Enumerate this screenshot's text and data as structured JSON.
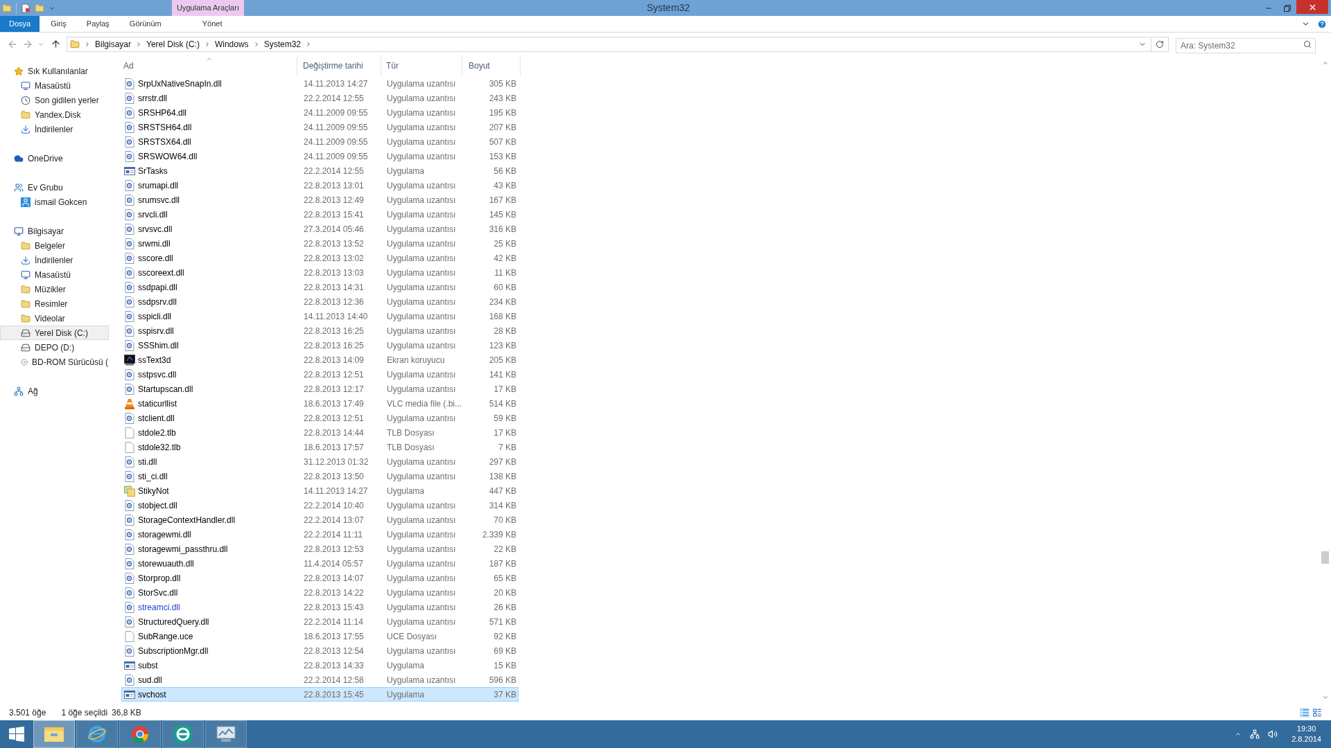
{
  "window": {
    "title": "System32",
    "context_tab": "Uygulama Araçları"
  },
  "ribbon_tabs": [
    {
      "label": "Dosya",
      "selected": true
    },
    {
      "label": "Giriş",
      "selected": false
    },
    {
      "label": "Paylaş",
      "selected": false
    },
    {
      "label": "Görünüm",
      "selected": false
    },
    {
      "label": "Yönet",
      "selected": false
    }
  ],
  "breadcrumbs": [
    "Bilgisayar",
    "Yerel Disk (C:)",
    "Windows",
    "System32"
  ],
  "search": {
    "placeholder": "Ara: System32"
  },
  "sidebar": {
    "groups": [
      {
        "label": "Sık Kullanılanlar",
        "kind": "star",
        "selected": false,
        "children": [
          {
            "label": "Masaüstü",
            "kind": "desktop",
            "selected": false
          },
          {
            "label": "Son gidilen yerler",
            "kind": "recent",
            "selected": false
          },
          {
            "label": "Yandex.Disk",
            "kind": "folder",
            "selected": false
          },
          {
            "label": "İndirilenler",
            "kind": "download",
            "selected": false
          }
        ]
      },
      {
        "label": "OneDrive",
        "kind": "cloud",
        "selected": false
      },
      {
        "label": "Ev Grubu",
        "kind": "homegroup",
        "selected": false,
        "children": [
          {
            "label": "ismail Gokcen",
            "kind": "user",
            "selected": false
          }
        ]
      },
      {
        "label": "Bilgisayar",
        "kind": "computer",
        "selected": false,
        "children": [
          {
            "label": "Belgeler",
            "kind": "folder",
            "selected": false
          },
          {
            "label": "İndirilenler",
            "kind": "download",
            "selected": false
          },
          {
            "label": "Masaüstü",
            "kind": "desktop",
            "selected": false
          },
          {
            "label": "Müzikler",
            "kind": "folder",
            "selected": false
          },
          {
            "label": "Resimler",
            "kind": "folder",
            "selected": false
          },
          {
            "label": "Videolar",
            "kind": "folder",
            "selected": false
          },
          {
            "label": "Yerel Disk (C:)",
            "kind": "drive",
            "selected": true
          },
          {
            "label": "DEPO (D:)",
            "kind": "drive",
            "selected": false
          },
          {
            "label": "BD-ROM Sürücüsü (",
            "kind": "disc",
            "selected": false
          }
        ]
      },
      {
        "label": "Ağ",
        "kind": "network",
        "selected": false
      }
    ]
  },
  "table": {
    "columns": [
      "Ad",
      "Değiştirme tarihi",
      "Tür",
      "Boyut"
    ],
    "rows": [
      {
        "name": "SrpUxNativeSnapIn.dll",
        "date": "14.11.2013 14:27",
        "type": "Uygulama uzantısı",
        "size": "305 KB",
        "kind": "dll",
        "compressed": false,
        "selected": false
      },
      {
        "name": "srrstr.dll",
        "date": "22.2.2014 12:55",
        "type": "Uygulama uzantısı",
        "size": "243 KB",
        "kind": "dll",
        "compressed": false,
        "selected": false
      },
      {
        "name": "SRSHP64.dll",
        "date": "24.11.2009 09:55",
        "type": "Uygulama uzantısı",
        "size": "195 KB",
        "kind": "dll",
        "compressed": false,
        "selected": false
      },
      {
        "name": "SRSTSH64.dll",
        "date": "24.11.2009 09:55",
        "type": "Uygulama uzantısı",
        "size": "207 KB",
        "kind": "dll",
        "compressed": false,
        "selected": false
      },
      {
        "name": "SRSTSX64.dll",
        "date": "24.11.2009 09:55",
        "type": "Uygulama uzantısı",
        "size": "507 KB",
        "kind": "dll",
        "compressed": false,
        "selected": false
      },
      {
        "name": "SRSWOW64.dll",
        "date": "24.11.2009 09:55",
        "type": "Uygulama uzantısı",
        "size": "153 KB",
        "kind": "dll",
        "compressed": false,
        "selected": false
      },
      {
        "name": "SrTasks",
        "date": "22.2.2014 12:55",
        "type": "Uygulama",
        "size": "56 KB",
        "kind": "exe",
        "compressed": false,
        "selected": false
      },
      {
        "name": "srumapi.dll",
        "date": "22.8.2013 13:01",
        "type": "Uygulama uzantısı",
        "size": "43 KB",
        "kind": "dll",
        "compressed": false,
        "selected": false
      },
      {
        "name": "srumsvc.dll",
        "date": "22.8.2013 12:49",
        "type": "Uygulama uzantısı",
        "size": "167 KB",
        "kind": "dll",
        "compressed": false,
        "selected": false
      },
      {
        "name": "srvcli.dll",
        "date": "22.8.2013 15:41",
        "type": "Uygulama uzantısı",
        "size": "145 KB",
        "kind": "dll",
        "compressed": false,
        "selected": false
      },
      {
        "name": "srvsvc.dll",
        "date": "27.3.2014 05:46",
        "type": "Uygulama uzantısı",
        "size": "316 KB",
        "kind": "dll",
        "compressed": false,
        "selected": false
      },
      {
        "name": "srwmi.dll",
        "date": "22.8.2013 13:52",
        "type": "Uygulama uzantısı",
        "size": "25 KB",
        "kind": "dll",
        "compressed": false,
        "selected": false
      },
      {
        "name": "sscore.dll",
        "date": "22.8.2013 13:02",
        "type": "Uygulama uzantısı",
        "size": "42 KB",
        "kind": "dll",
        "compressed": false,
        "selected": false
      },
      {
        "name": "sscoreext.dll",
        "date": "22.8.2013 13:03",
        "type": "Uygulama uzantısı",
        "size": "11 KB",
        "kind": "dll",
        "compressed": false,
        "selected": false
      },
      {
        "name": "ssdpapi.dll",
        "date": "22.8.2013 14:31",
        "type": "Uygulama uzantısı",
        "size": "60 KB",
        "kind": "dll",
        "compressed": false,
        "selected": false
      },
      {
        "name": "ssdpsrv.dll",
        "date": "22.8.2013 12:36",
        "type": "Uygulama uzantısı",
        "size": "234 KB",
        "kind": "dll",
        "compressed": false,
        "selected": false
      },
      {
        "name": "sspicli.dll",
        "date": "14.11.2013 14:40",
        "type": "Uygulama uzantısı",
        "size": "168 KB",
        "kind": "dll",
        "compressed": false,
        "selected": false
      },
      {
        "name": "sspisrv.dll",
        "date": "22.8.2013 16:25",
        "type": "Uygulama uzantısı",
        "size": "28 KB",
        "kind": "dll",
        "compressed": false,
        "selected": false
      },
      {
        "name": "SSShim.dll",
        "date": "22.8.2013 16:25",
        "type": "Uygulama uzantısı",
        "size": "123 KB",
        "kind": "dll",
        "compressed": false,
        "selected": false
      },
      {
        "name": "ssText3d",
        "date": "22.8.2013 14:09",
        "type": "Ekran koruyucu",
        "size": "205 KB",
        "kind": "screensaver",
        "compressed": false,
        "selected": false
      },
      {
        "name": "sstpsvc.dll",
        "date": "22.8.2013 12:51",
        "type": "Uygulama uzantısı",
        "size": "141 KB",
        "kind": "dll",
        "compressed": false,
        "selected": false
      },
      {
        "name": "Startupscan.dll",
        "date": "22.8.2013 12:17",
        "type": "Uygulama uzantısı",
        "size": "17 KB",
        "kind": "dll",
        "compressed": false,
        "selected": false
      },
      {
        "name": "staticurllist",
        "date": "18.6.2013 17:49",
        "type": "VLC media file (.bi...",
        "size": "514 KB",
        "kind": "cone",
        "compressed": false,
        "selected": false
      },
      {
        "name": "stclient.dll",
        "date": "22.8.2013 12:51",
        "type": "Uygulama uzantısı",
        "size": "59 KB",
        "kind": "dll",
        "compressed": false,
        "selected": false
      },
      {
        "name": "stdole2.tlb",
        "date": "22.8.2013 14:44",
        "type": "TLB Dosyası",
        "size": "17 KB",
        "kind": "blank",
        "compressed": false,
        "selected": false
      },
      {
        "name": "stdole32.tlb",
        "date": "18.6.2013 17:57",
        "type": "TLB Dosyası",
        "size": "7 KB",
        "kind": "blank",
        "compressed": false,
        "selected": false
      },
      {
        "name": "sti.dll",
        "date": "31.12.2013 01:32",
        "type": "Uygulama uzantısı",
        "size": "297 KB",
        "kind": "dll",
        "compressed": false,
        "selected": false
      },
      {
        "name": "sti_ci.dll",
        "date": "22.8.2013 13:50",
        "type": "Uygulama uzantısı",
        "size": "138 KB",
        "kind": "dll",
        "compressed": false,
        "selected": false
      },
      {
        "name": "StikyNot",
        "date": "14.11.2013 14:27",
        "type": "Uygulama",
        "size": "447 KB",
        "kind": "notes",
        "compressed": false,
        "selected": false
      },
      {
        "name": "stobject.dll",
        "date": "22.2.2014 10:40",
        "type": "Uygulama uzantısı",
        "size": "314 KB",
        "kind": "dll",
        "compressed": false,
        "selected": false
      },
      {
        "name": "StorageContextHandler.dll",
        "date": "22.2.2014 13:07",
        "type": "Uygulama uzantısı",
        "size": "70 KB",
        "kind": "dll",
        "compressed": false,
        "selected": false
      },
      {
        "name": "storagewmi.dll",
        "date": "22.2.2014 11:11",
        "type": "Uygulama uzantısı",
        "size": "2.339 KB",
        "kind": "dll",
        "compressed": false,
        "selected": false
      },
      {
        "name": "storagewmi_passthru.dll",
        "date": "22.8.2013 12:53",
        "type": "Uygulama uzantısı",
        "size": "22 KB",
        "kind": "dll",
        "compressed": false,
        "selected": false
      },
      {
        "name": "storewuauth.dll",
        "date": "11.4.2014 05:57",
        "type": "Uygulama uzantısı",
        "size": "187 KB",
        "kind": "dll",
        "compressed": false,
        "selected": false
      },
      {
        "name": "Storprop.dll",
        "date": "22.8.2013 14:07",
        "type": "Uygulama uzantısı",
        "size": "65 KB",
        "kind": "dll",
        "compressed": false,
        "selected": false
      },
      {
        "name": "StorSvc.dll",
        "date": "22.8.2013 14:22",
        "type": "Uygulama uzantısı",
        "size": "20 KB",
        "kind": "dll",
        "compressed": false,
        "selected": false
      },
      {
        "name": "streamci.dll",
        "date": "22.8.2013 15:43",
        "type": "Uygulama uzantısı",
        "size": "26 KB",
        "kind": "dll",
        "compressed": true,
        "selected": false
      },
      {
        "name": "StructuredQuery.dll",
        "date": "22.2.2014 11:14",
        "type": "Uygulama uzantısı",
        "size": "571 KB",
        "kind": "dll",
        "compressed": false,
        "selected": false
      },
      {
        "name": "SubRange.uce",
        "date": "18.6.2013 17:55",
        "type": "UCE Dosyası",
        "size": "92 KB",
        "kind": "blank",
        "compressed": false,
        "selected": false
      },
      {
        "name": "SubscriptionMgr.dll",
        "date": "22.8.2013 12:54",
        "type": "Uygulama uzantısı",
        "size": "69 KB",
        "kind": "dll",
        "compressed": false,
        "selected": false
      },
      {
        "name": "subst",
        "date": "22.8.2013 14:33",
        "type": "Uygulama",
        "size": "15 KB",
        "kind": "exe",
        "compressed": false,
        "selected": false
      },
      {
        "name": "sud.dll",
        "date": "22.2.2014 12:58",
        "type": "Uygulama uzantısı",
        "size": "596 KB",
        "kind": "dll",
        "compressed": false,
        "selected": false
      },
      {
        "name": "svchost",
        "date": "22.8.2013 15:45",
        "type": "Uygulama",
        "size": "37 KB",
        "kind": "exe",
        "compressed": false,
        "selected": true
      }
    ]
  },
  "status_bar": {
    "count": "3.501 öğe",
    "selection": "1 öğe seçildi",
    "selection_size": "36,8 KB"
  },
  "taskbar": {
    "apps": [
      {
        "kind": "explorer",
        "selected": true
      },
      {
        "kind": "browser-e",
        "selected": false
      },
      {
        "kind": "chrome",
        "selected": false
      },
      {
        "kind": "antivirus",
        "selected": false
      },
      {
        "kind": "monitor",
        "selected": false
      }
    ],
    "time": "19:30",
    "date": "2.8.2014"
  }
}
